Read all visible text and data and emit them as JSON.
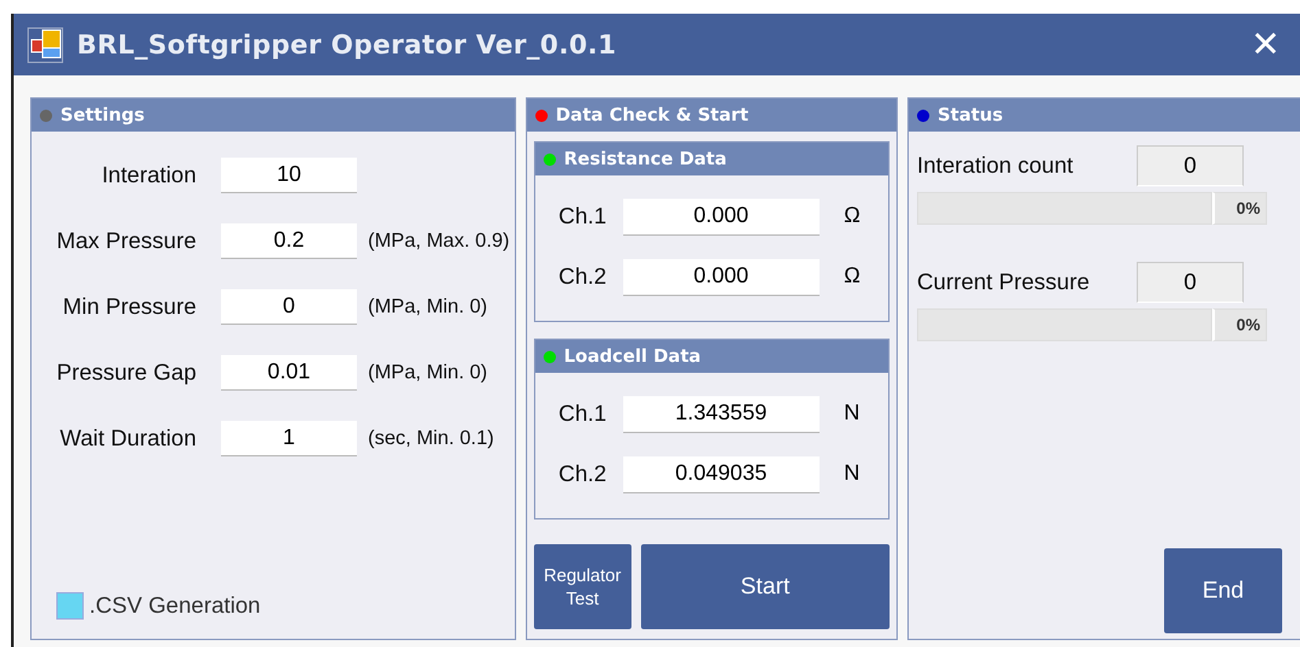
{
  "window": {
    "title": "BRL_Softgripper Operator Ver_0.0.1",
    "close": "✕"
  },
  "settings": {
    "title": "Settings",
    "color": "#666666",
    "fields": [
      {
        "label": "Interation",
        "value": "10"
      },
      {
        "label": "Max Pressure",
        "value": "0.2",
        "hint": "(MPa, Max. 0.9)"
      },
      {
        "label": "Min Pressure",
        "value": "0",
        "hint": "(MPa, Min. 0)"
      },
      {
        "label": "Pressure Gap",
        "value": "0.01",
        "hint": "(MPa, Min. 0)"
      },
      {
        "label": "Wait Duration",
        "value": "1",
        "hint": "(sec, Min. 0.1)"
      }
    ],
    "csv": {
      "label": ".CSV Generation",
      "checked": true
    }
  },
  "data_check": {
    "title": "Data Check & Start",
    "color": "#ff0000",
    "groups": [
      {
        "title": "Resistance Data",
        "color": "#00dd00",
        "channels": [
          {
            "label": "Ch.1",
            "value": "0.000",
            "unit": "Ω"
          },
          {
            "label": "Ch.2",
            "value": "0.000",
            "unit": "Ω"
          }
        ]
      },
      {
        "title": "Loadcell Data",
        "color": "#00dd00",
        "channels": [
          {
            "label": "Ch.1",
            "value": "1.343559",
            "unit": "N"
          },
          {
            "label": "Ch.2",
            "value": "0.049035",
            "unit": "N"
          }
        ]
      }
    ],
    "buttons": [
      {
        "label": "Regulator Test",
        "kind": "small"
      },
      {
        "label": "Start",
        "kind": "wide"
      }
    ]
  },
  "status": {
    "title": "Status",
    "color": "#0000cc",
    "items": [
      {
        "label": "Interation count",
        "value": "0",
        "level": 0,
        "percent": "0%"
      },
      {
        "label": "Current Pressure",
        "value": "0",
        "level": 0,
        "percent": "0%"
      }
    ],
    "end_button": "End"
  }
}
